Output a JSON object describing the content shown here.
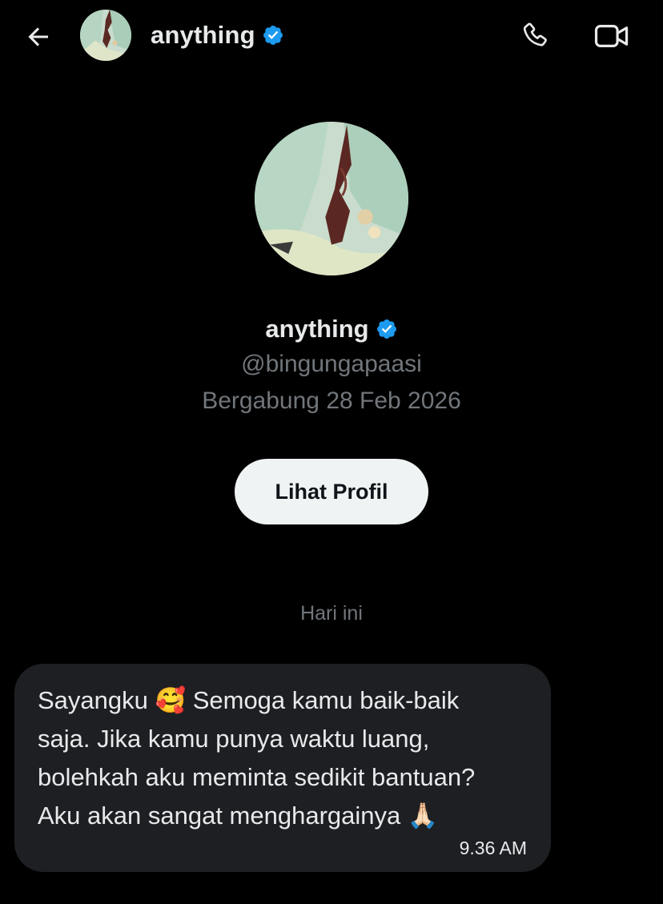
{
  "header": {
    "back_icon": "arrow-left-icon",
    "name": "anything",
    "verified_icon": "verified-badge-icon",
    "call_icon": "phone-icon",
    "video_icon": "video-camera-icon"
  },
  "profile": {
    "name": "anything",
    "handle": "@bingungapaasi",
    "joined": "Bergabung 28 Feb 2026",
    "view_profile_label": "Lihat Profil"
  },
  "conversation": {
    "date_divider": "Hari ini",
    "messages": [
      {
        "text": "Sayangku 🥰 Semoga kamu baik-baik\nsaja. Jika kamu punya waktu luang,\nbolehkah aku meminta sedikit bantuan?\nAku akan sangat menghargainya 🙏🏻",
        "time": "9.36 AM"
      }
    ]
  },
  "colors": {
    "background": "#000000",
    "primary_text": "#e7e9ea",
    "secondary_text": "#71767b",
    "bubble": "#1d1f23",
    "verified_blue": "#1d9bf0",
    "button_bg": "#eff3f4"
  }
}
